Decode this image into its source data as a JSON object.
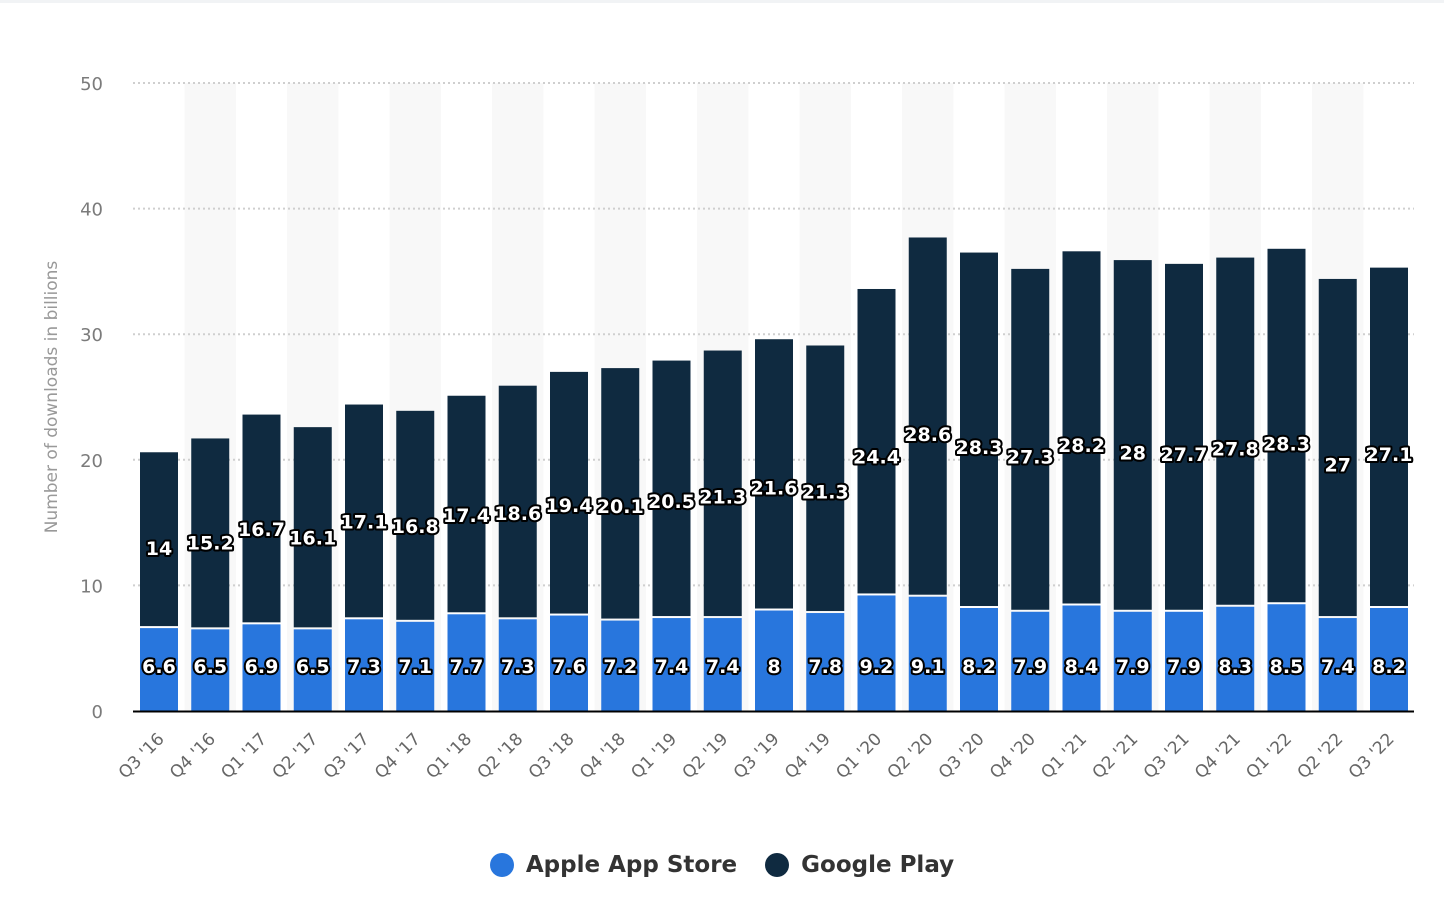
{
  "chart_data": {
    "type": "bar",
    "stacked": true,
    "title": "",
    "xlabel": "",
    "ylabel": "Number of downloads in billions",
    "ylim": [
      0,
      50
    ],
    "yticks": [
      0,
      10,
      20,
      30,
      40,
      50
    ],
    "grid": true,
    "legend_position": "bottom-center",
    "categories": [
      "Q3 '16",
      "Q4 '16",
      "Q1 '17",
      "Q2 '17",
      "Q3 '17",
      "Q4 '17",
      "Q1 '18",
      "Q2 '18",
      "Q3 '18",
      "Q4 '18",
      "Q1 '19",
      "Q2 '19",
      "Q3 '19",
      "Q4 '19",
      "Q1 '20",
      "Q2 '20",
      "Q3 '20",
      "Q4 '20",
      "Q1 '21",
      "Q2 '21",
      "Q3 '21",
      "Q4 '21",
      "Q1 '22",
      "Q2 '22",
      "Q3 '22"
    ],
    "series": [
      {
        "name": "Apple App Store",
        "color": "#2876dd",
        "values": [
          6.6,
          6.5,
          6.9,
          6.5,
          7.3,
          7.1,
          7.7,
          7.3,
          7.6,
          7.2,
          7.4,
          7.4,
          8,
          7.8,
          9.2,
          9.1,
          8.2,
          7.9,
          8.4,
          7.9,
          7.9,
          8.3,
          8.5,
          7.4,
          8.2
        ]
      },
      {
        "name": "Google Play",
        "color": "#0f2a40",
        "values": [
          14,
          15.2,
          16.7,
          16.1,
          17.1,
          16.8,
          17.4,
          18.6,
          19.4,
          20.1,
          20.5,
          21.3,
          21.6,
          21.3,
          24.4,
          28.6,
          28.3,
          27.3,
          28.2,
          28,
          27.7,
          27.8,
          28.3,
          27,
          27.1
        ]
      }
    ]
  },
  "legend": {
    "items": [
      {
        "label": "Apple App Store",
        "color": "#2876dd"
      },
      {
        "label": "Google Play",
        "color": "#0f2a40"
      }
    ]
  }
}
